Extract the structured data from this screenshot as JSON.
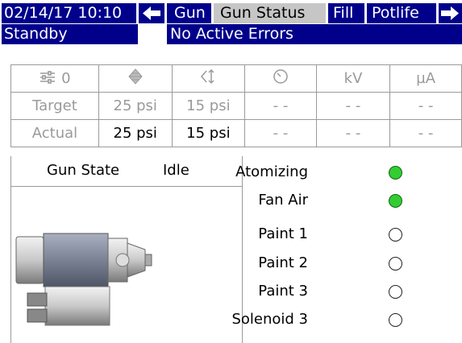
{
  "header": {
    "datetime": "02/14/17 10:10",
    "tabs": [
      {
        "label": "Gun",
        "active": false
      },
      {
        "label": "Gun Status",
        "active": true
      },
      {
        "label": "Fill",
        "active": false
      },
      {
        "label": "Potlife",
        "active": false
      }
    ]
  },
  "status": {
    "state": "Standby",
    "errors": "No Active Errors"
  },
  "table": {
    "header_icons": [
      "flow-adjust-icon",
      "fan-pattern-icon",
      "valve-icon",
      "gauge-icon"
    ],
    "flow_value": "0",
    "kv_label": "kV",
    "ua_label": "µA",
    "rows": [
      {
        "label": "Target",
        "values": [
          "25 psi",
          "15 psi",
          "- -",
          "- -",
          "- -"
        ]
      },
      {
        "label": "Actual",
        "values": [
          "25 psi",
          "15 psi",
          "- -",
          "- -",
          "- -"
        ]
      }
    ]
  },
  "gun": {
    "state_label": "Gun State",
    "state_value": "Idle"
  },
  "valves": [
    {
      "label": "Atomizing",
      "on": true
    },
    {
      "label": "Fan Air",
      "on": true
    },
    {
      "label": "Paint 1",
      "on": false
    },
    {
      "label": "Paint 2",
      "on": false
    },
    {
      "label": "Paint 3",
      "on": false
    },
    {
      "label": "Solenoid 3",
      "on": false
    }
  ],
  "colors": {
    "bar": "#00008b",
    "active_tab": "#c6c6c6",
    "led_on": "#33cc33"
  }
}
